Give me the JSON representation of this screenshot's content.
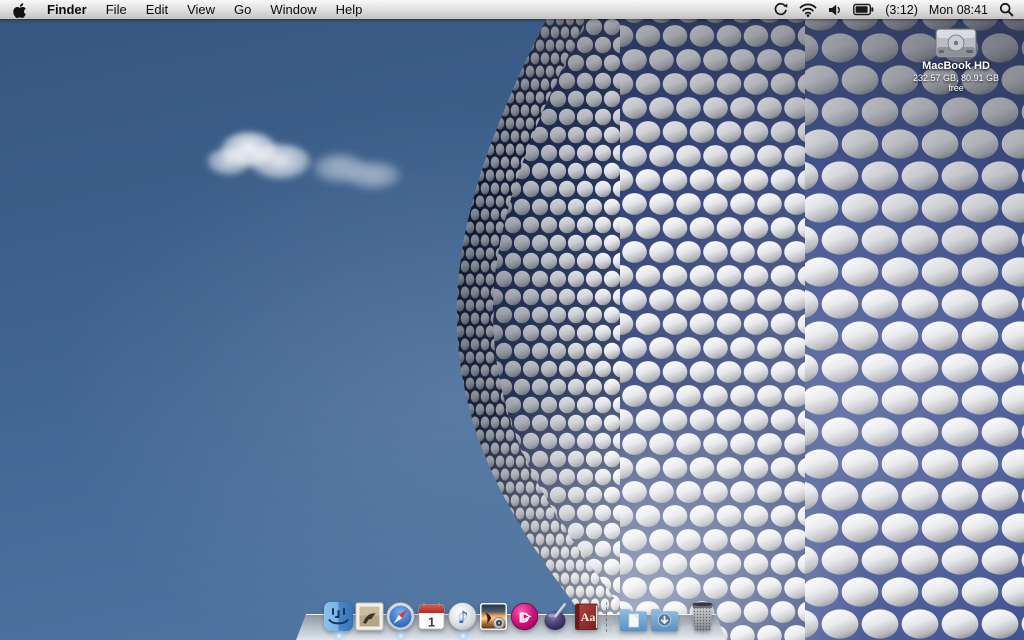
{
  "menu_bar": {
    "apple_logo": "apple-logo",
    "items": [
      {
        "label": "Finder",
        "active": true
      },
      {
        "label": "File"
      },
      {
        "label": "Edit"
      },
      {
        "label": "View"
      },
      {
        "label": "Go"
      },
      {
        "label": "Window"
      },
      {
        "label": "Help"
      }
    ],
    "status": {
      "icons": [
        "sync-arrows-icon",
        "wifi-icon",
        "volume-icon",
        "battery-icon",
        "spotlight-icon"
      ],
      "battery": {
        "time_remaining": "(3:12)"
      },
      "clock": "Mon 08:41"
    }
  },
  "desktop": {
    "volume_icon": {
      "label": "MacBook HD",
      "info": "232.57 GB, 80.91 GB free",
      "icon": "hard-drive-icon"
    },
    "wallpaper": {
      "subject": "selfridges-disc-facade",
      "sky_top": "#35567f",
      "sky_bottom": "#527aa6",
      "disc_gap_blue": "#2b3e85"
    }
  },
  "dock": {
    "items": [
      {
        "id": "finder",
        "icon": "finder-face-icon",
        "running": true
      },
      {
        "id": "mail",
        "icon": "mail-stamp-icon",
        "running": false
      },
      {
        "id": "safari",
        "icon": "safari-compass-icon",
        "running": true
      },
      {
        "id": "ical",
        "icon": "calendar-icon",
        "day": "1",
        "running": false
      },
      {
        "id": "itunes",
        "icon": "itunes-disc-note-icon",
        "running": true
      },
      {
        "id": "iphoto",
        "icon": "photo-camera-icon",
        "running": false
      },
      {
        "id": "idvd",
        "icon": "idvd-disc-icon",
        "glyph": "D",
        "running": false
      },
      {
        "id": "ink-pen",
        "icon": "inkwell-pen-icon",
        "running": false
      },
      {
        "id": "dictionary",
        "icon": "dictionary-book-icon",
        "glyph": "Aa",
        "running": false
      }
    ],
    "stacks": [
      {
        "id": "documents",
        "icon": "folder-document-icon"
      },
      {
        "id": "downloads",
        "icon": "folder-download-icon"
      }
    ],
    "trash": {
      "id": "trash",
      "icon": "wire-trash-basket-icon"
    }
  }
}
